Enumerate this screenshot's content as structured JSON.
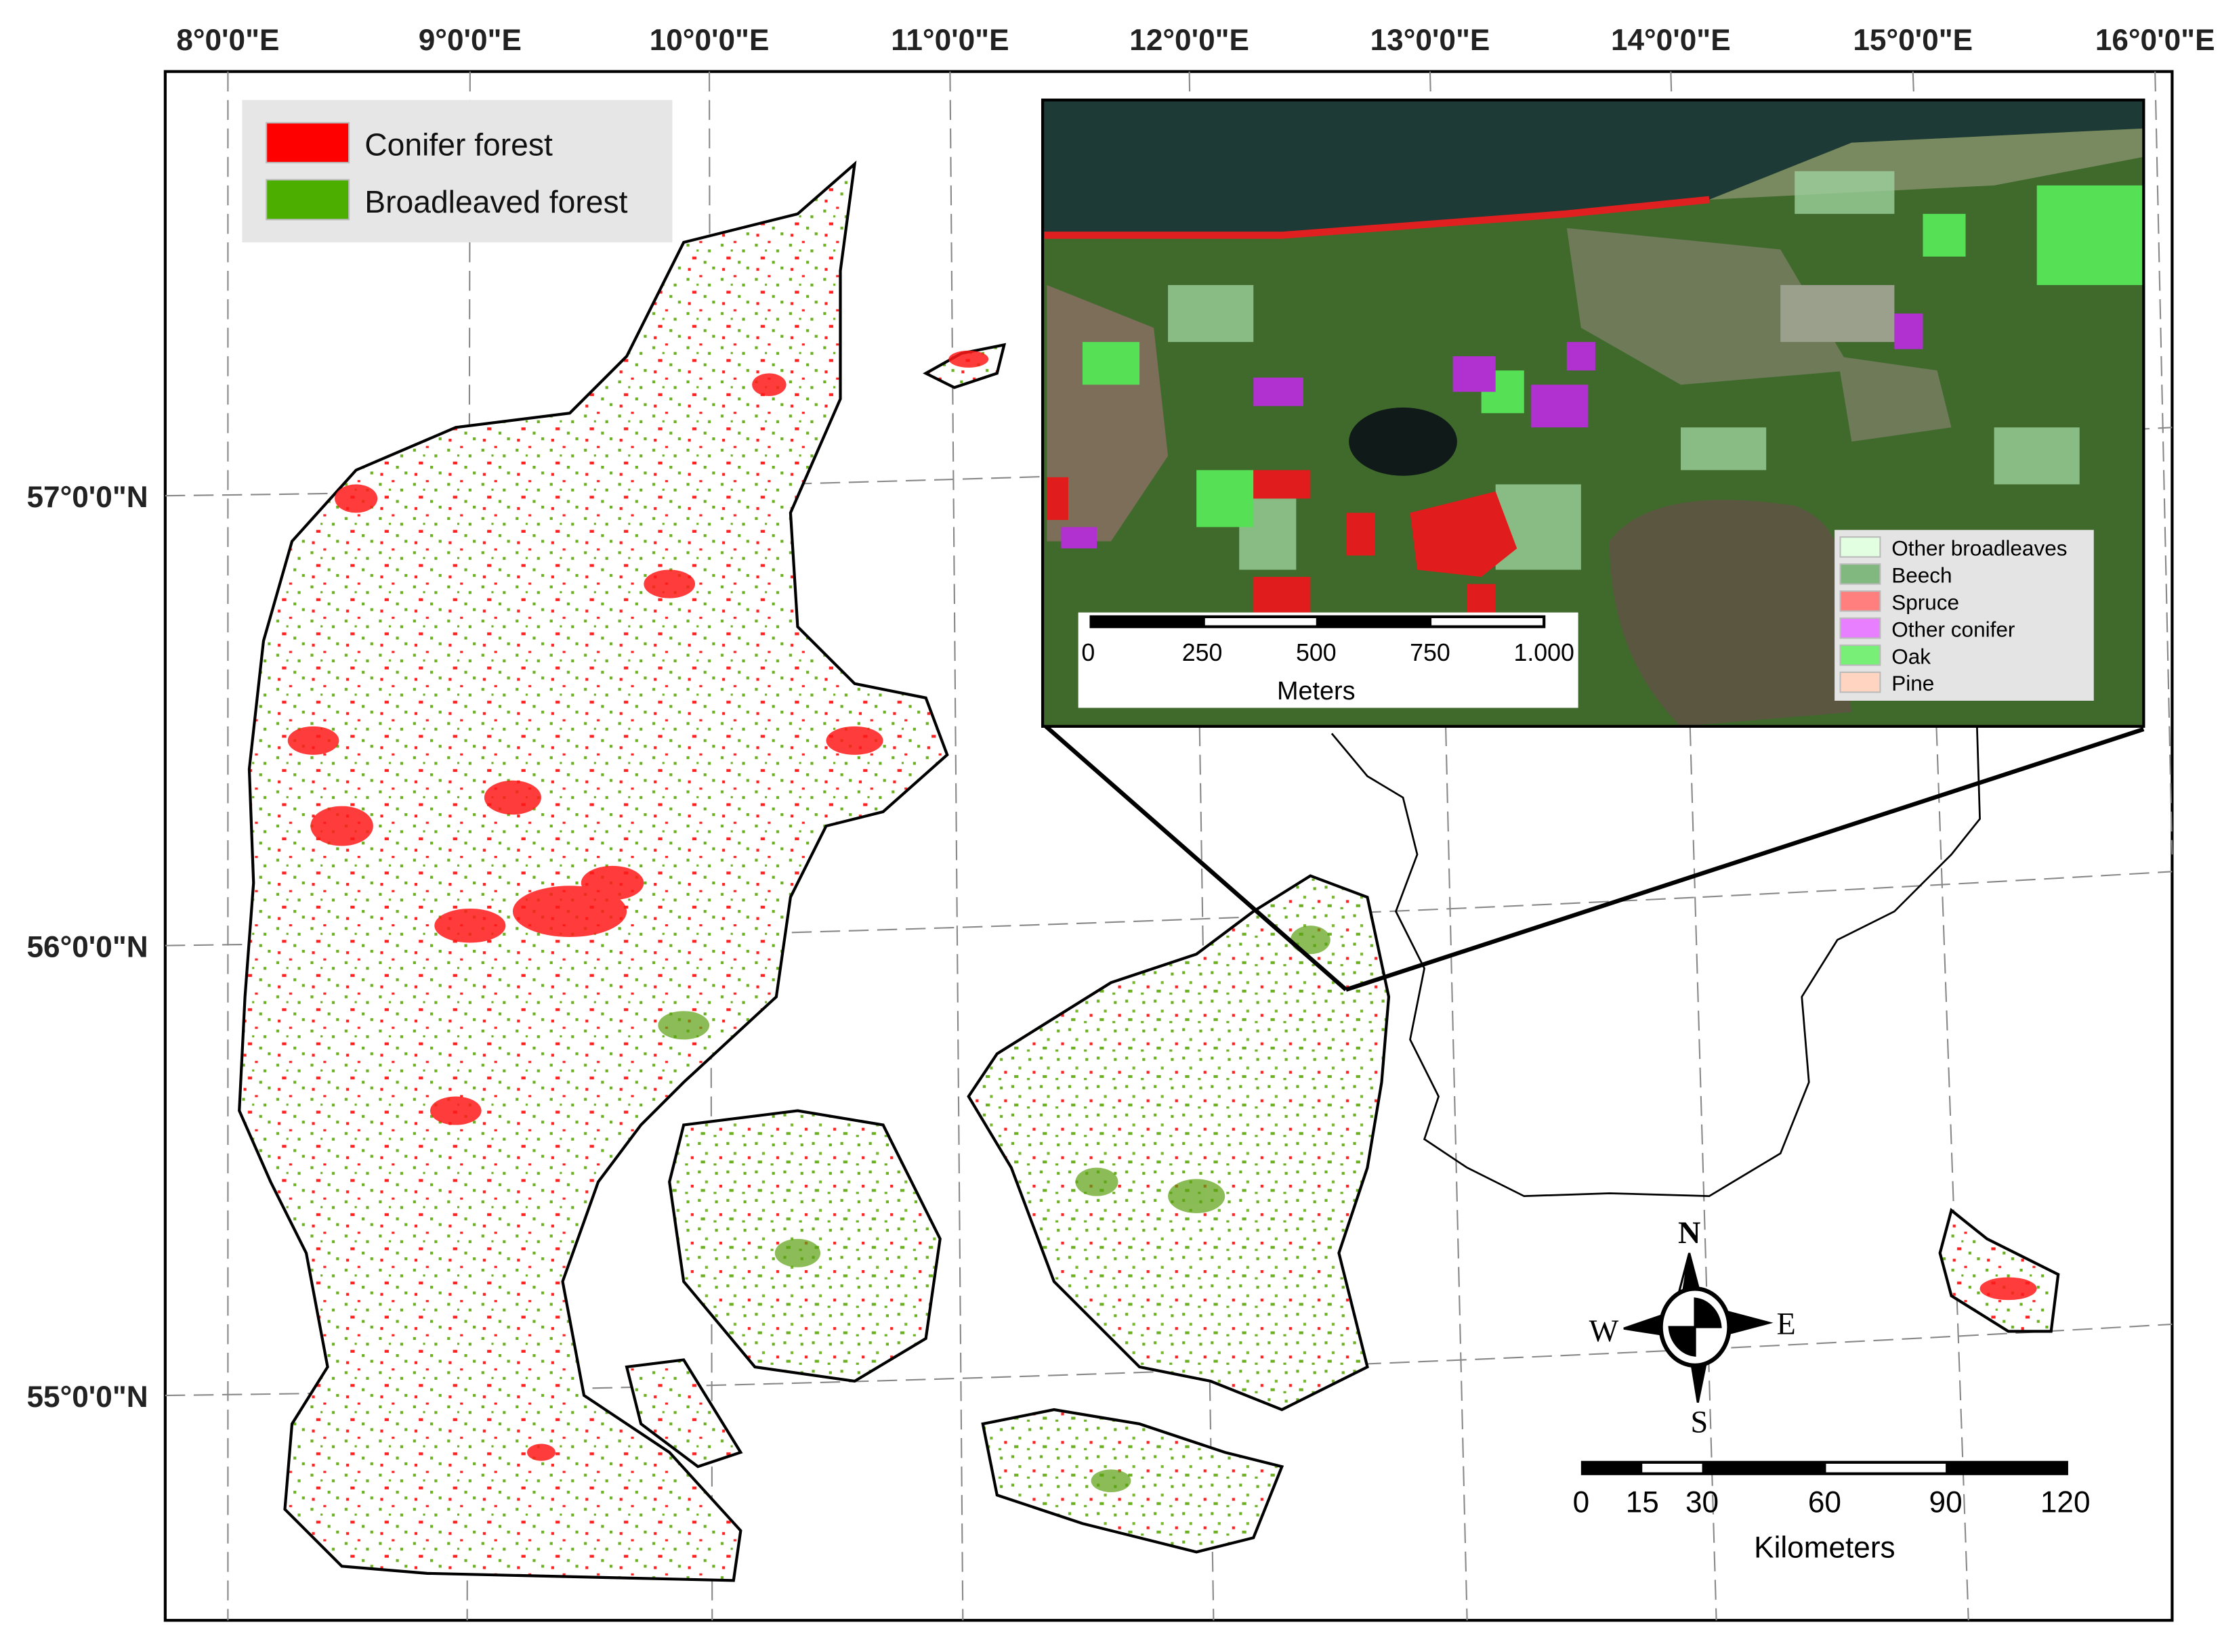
{
  "map": {
    "longitude_labels": [
      "8°0'0\"E",
      "9°0'0\"E",
      "10°0'0\"E",
      "11°0'0\"E",
      "12°0'0\"E",
      "13°0'0\"E",
      "14°0'0\"E",
      "15°0'0\"E",
      "16°0'0\"E"
    ],
    "latitude_labels": [
      "57°0'0\"N",
      "56°0'0\"N",
      "55°0'0\"N"
    ]
  },
  "legend": {
    "items": [
      {
        "label": "Conifer forest",
        "color": "#ff0000"
      },
      {
        "label": "Broadleaved forest",
        "color": "#4caf00"
      }
    ]
  },
  "inset": {
    "legend": [
      {
        "label": "Other broadleaves",
        "color": "#e2ffe2"
      },
      {
        "label": "Beech",
        "color": "#80b880"
      },
      {
        "label": "Spruce",
        "color": "#ff7f7f"
      },
      {
        "label": "Other conifer",
        "color": "#e87fff"
      },
      {
        "label": "Oak",
        "color": "#78f078"
      },
      {
        "label": "Pine",
        "color": "#ffd4c0"
      }
    ],
    "scale": {
      "ticks": [
        "0",
        "250",
        "500",
        "750",
        "1.000"
      ],
      "unit": "Meters"
    }
  },
  "scale_bar": {
    "ticks": [
      "0",
      "15",
      "30",
      "60",
      "90",
      "120"
    ],
    "unit": "Kilometers"
  },
  "compass": {
    "n": "N",
    "s": "S",
    "e": "E",
    "w": "W"
  }
}
